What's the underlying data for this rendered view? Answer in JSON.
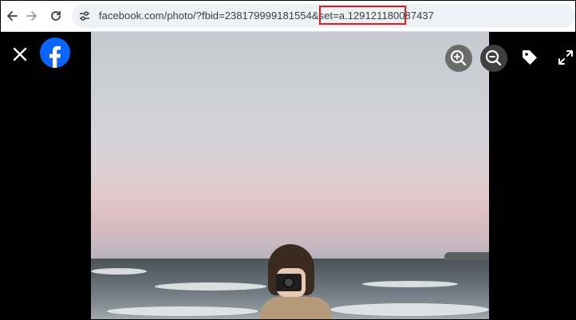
{
  "browser": {
    "address_bar": {
      "url_prefix": "facebook.com/photo/?fbid=238179999181554&set=",
      "url_highlighted": "a.129121180087437"
    },
    "highlight_color": "#e01b1b"
  },
  "viewer": {
    "controls": [
      {
        "name": "close",
        "icon": "close-icon"
      },
      {
        "name": "facebook-logo",
        "icon": "facebook-logo"
      },
      {
        "name": "zoom-in",
        "icon": "zoom-in-icon"
      },
      {
        "name": "zoom-out",
        "icon": "zoom-out-icon"
      },
      {
        "name": "tag",
        "icon": "tag-icon"
      },
      {
        "name": "fullscreen",
        "icon": "fullscreen-icon"
      }
    ],
    "background": "#000000",
    "brand_color": "#0866ff"
  }
}
